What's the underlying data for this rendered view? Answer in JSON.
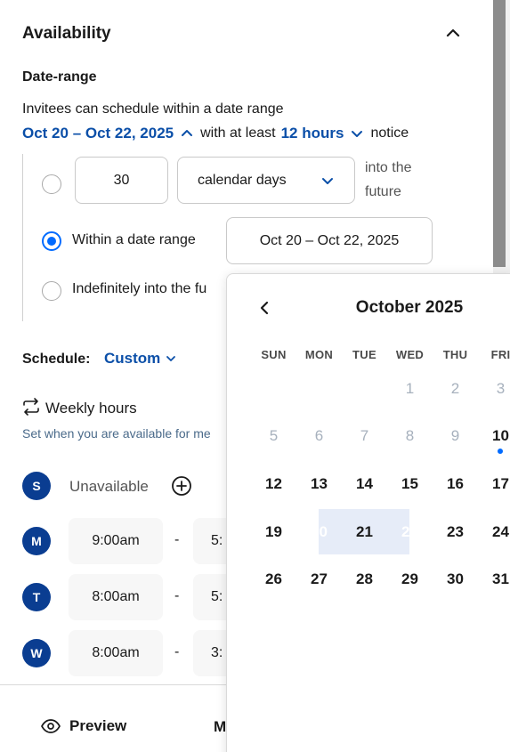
{
  "availability": {
    "title": "Availability",
    "date_range_heading": "Date-range",
    "desc": "Invitees can schedule within a date range",
    "range_link": "Oct 20 – Oct 22, 2025",
    "with_at_least": "with at least",
    "notice_link": "12 hours",
    "notice": "notice",
    "option_days_value": "30",
    "option_days_unit": "calendar days",
    "into_future_line1": "into the",
    "into_future_line2": "future",
    "option_within": "Within a date range",
    "date_range_value": "Oct 20 – Oct 22, 2025",
    "option_indefinitely": "Indefinitely into the fu"
  },
  "schedule": {
    "label": "Schedule:",
    "value": "Custom"
  },
  "weekly": {
    "title": "Weekly hours",
    "desc": "Set when you are available for me",
    "rows": [
      {
        "day": "S",
        "status": "Unavailable"
      },
      {
        "day": "M",
        "start": "9:00am",
        "dash": "-",
        "end_partial": "5:"
      },
      {
        "day": "T",
        "start": "8:00am",
        "dash": "-",
        "end_partial": "5:"
      },
      {
        "day": "W",
        "start": "8:00am",
        "dash": "-",
        "end_partial": "3:"
      }
    ]
  },
  "footer": {
    "preview": "Preview",
    "more_partial": "M"
  },
  "calendar": {
    "month": "October 2025",
    "dows": [
      "SUN",
      "MON",
      "TUE",
      "WED",
      "THU",
      "FRI"
    ],
    "weeks": [
      [
        "",
        "",
        "",
        "1",
        "2",
        "3"
      ],
      [
        "5",
        "6",
        "7",
        "8",
        "9",
        "10"
      ],
      [
        "12",
        "13",
        "14",
        "15",
        "16",
        "17"
      ],
      [
        "19",
        "20",
        "21",
        "22",
        "23",
        "24"
      ],
      [
        "26",
        "27",
        "28",
        "29",
        "30",
        "31"
      ]
    ]
  },
  "colors": {
    "accent": "#006bff",
    "link": "#0b4fa8",
    "badge": "#0a3d91"
  }
}
